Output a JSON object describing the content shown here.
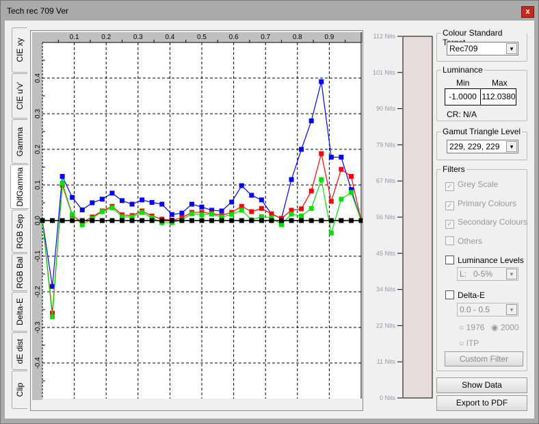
{
  "window": {
    "title": "Tech rec 709 Ver",
    "close_label": "x"
  },
  "tabs": [
    {
      "label": "CIE xy"
    },
    {
      "label": "CIE u'v'"
    },
    {
      "label": "Gamma"
    },
    {
      "label": "DifGamma",
      "active": true
    },
    {
      "label": "RGB Sep"
    },
    {
      "label": "RGB Bal"
    },
    {
      "label": "Delta-E"
    },
    {
      "label": "dE dist"
    },
    {
      "label": "Clip"
    }
  ],
  "chart_data": {
    "type": "line",
    "xlim": [
      0,
      1
    ],
    "ylim": [
      -0.5,
      0.5
    ],
    "xticks": [
      "0.1",
      "0.2",
      "0.3",
      "0.4",
      "0.5",
      "0.6",
      "0.7",
      "0.8",
      "0.9"
    ],
    "yticks": [
      "0.4",
      "0.3",
      "0.2",
      "0.1",
      "0.0",
      "-0.1",
      "-0.2",
      "-0.3",
      "-0.4"
    ],
    "grid": true,
    "x_step": 0.03125,
    "series": [
      {
        "name": "black",
        "color": "#000000",
        "values": [
          0,
          0,
          0,
          0,
          0,
          0,
          0,
          0,
          0,
          0,
          0,
          0,
          0,
          0,
          0,
          0,
          0,
          0,
          0,
          0,
          0,
          0,
          0,
          0,
          0,
          0,
          0,
          0,
          0,
          0,
          0,
          0,
          0
        ]
      },
      {
        "name": "green",
        "color": "#00e000",
        "values": [
          0,
          -0.27,
          0.105,
          0.017,
          -0.012,
          0.006,
          0.025,
          0.036,
          0.011,
          0.01,
          0.023,
          0.008,
          -0.006,
          -0.006,
          0.002,
          0.019,
          0.016,
          0.018,
          0.01,
          0.017,
          0.029,
          0.002,
          0.011,
          0.008,
          -0.011,
          0.018,
          0.013,
          0.034,
          0.115,
          -0.035,
          0.06,
          0.079,
          0
        ]
      },
      {
        "name": "red",
        "color": "#ff0000",
        "values": [
          0,
          -0.26,
          0.1,
          0.015,
          -0.005,
          0.01,
          0.027,
          0.04,
          0.016,
          0.014,
          0.027,
          0.013,
          0.004,
          0.001,
          0.008,
          0.023,
          0.023,
          0.02,
          0.015,
          0.023,
          0.04,
          0.025,
          0.034,
          0.019,
          0.006,
          0.029,
          0.033,
          0.083,
          0.188,
          0.054,
          0.144,
          0.124,
          0
        ]
      },
      {
        "name": "blue",
        "color": "#0000ff",
        "values": [
          0,
          -0.185,
          0.124,
          0.065,
          0.03,
          0.05,
          0.06,
          0.077,
          0.056,
          0.046,
          0.058,
          0.051,
          0.046,
          0.017,
          0.021,
          0.046,
          0.038,
          0.029,
          0.027,
          0.052,
          0.098,
          0.071,
          0.058,
          0.018,
          0.006,
          0.115,
          0.2,
          0.28,
          0.39,
          0.178,
          0.178,
          0.087,
          0
        ]
      }
    ]
  },
  "luminance_scale": {
    "labels": [
      "112 Nits",
      "101 Nits",
      "90 Nits",
      "79 Nits",
      "67 Nits",
      "56 Nits",
      "45 Nits",
      "34 Nits",
      "22 Nits",
      "11 Nits",
      "0 Nits"
    ],
    "bar_color": "#e8dcdc"
  },
  "panel": {
    "colour_standard": {
      "label": "Colour Standard Target",
      "value": "Rec709"
    },
    "luminance": {
      "label": "Luminance",
      "min_label": "Min",
      "max_label": "Max",
      "min": "-1.0000",
      "max": "112.0380",
      "cr": "CR: N/A"
    },
    "gamut": {
      "label": "Gamut Triangle Level",
      "value": "229, 229, 229"
    },
    "filters": {
      "label": "Filters",
      "grey_scale": "Grey Scale",
      "primary": "Primary Colours",
      "secondary": "Secondary Colours",
      "others": "Others",
      "lum_levels": "Luminance Levels",
      "lum_value": "L:   0-5%",
      "delta_e": "Delta-E",
      "de_value": "0.0 - 0.5",
      "r1976": "1976",
      "r2000": "2000",
      "itp": "ITP",
      "custom": "Custom Filter"
    },
    "show_data": "Show Data",
    "export_pdf": "Export to PDF"
  }
}
